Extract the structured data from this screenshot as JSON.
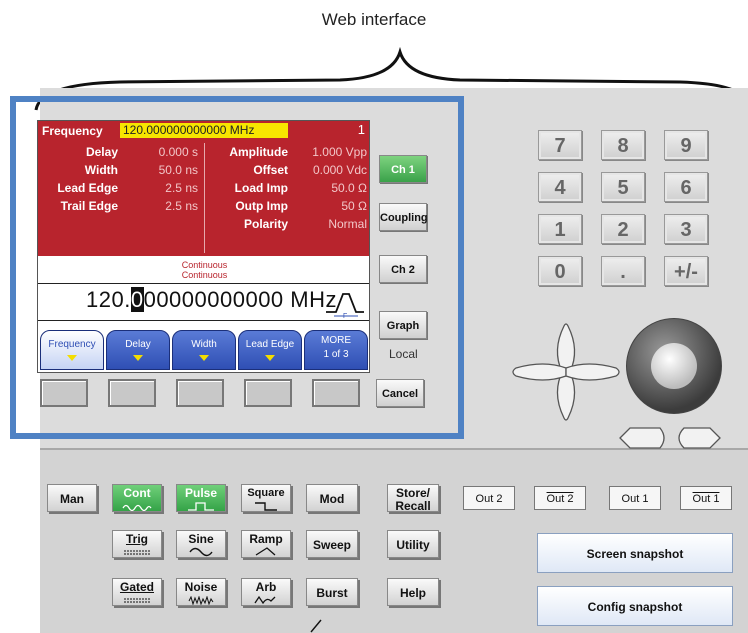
{
  "caption": "Web interface",
  "screen": {
    "header": {
      "label": "Frequency",
      "value": "120.000000000000 MHz",
      "channel": "1"
    },
    "params_left": [
      {
        "label": "Delay",
        "value": "0.000 s"
      },
      {
        "label": "Width",
        "value": "50.0 ns"
      },
      {
        "label": "Lead Edge",
        "value": "2.5 ns"
      },
      {
        "label": "Trail Edge",
        "value": "2.5 ns"
      }
    ],
    "params_right": [
      {
        "label": "Amplitude",
        "value": "1.000 Vpp"
      },
      {
        "label": "Offset",
        "value": "0.000 Vdc"
      },
      {
        "label": "Load Imp",
        "value": "50.0 Ω"
      },
      {
        "label": "Outp Imp",
        "value": "50 Ω"
      },
      {
        "label": "Polarity",
        "value": "Normal"
      }
    ],
    "mode_line1": "Continuous",
    "mode_line2": "Continuous",
    "entry": {
      "before": "120.",
      "cursor": "0",
      "after": "00000000000 MHz"
    },
    "softkeys": [
      {
        "label": "Frequency",
        "label2": "",
        "active": true,
        "arrow": true
      },
      {
        "label": "Delay",
        "label2": "",
        "active": false,
        "arrow": true
      },
      {
        "label": "Width",
        "label2": "",
        "active": false,
        "arrow": true
      },
      {
        "label": "Lead Edge",
        "label2": "",
        "active": false,
        "arrow": true
      },
      {
        "label": "MORE",
        "label2": "1 of 3",
        "active": false,
        "arrow": false
      }
    ]
  },
  "side_buttons": {
    "ch1": "Ch 1",
    "coupling": "Coupling",
    "ch2": "Ch 2",
    "graph": "Graph",
    "local": "Local",
    "cancel": "Cancel"
  },
  "keypad": [
    "7",
    "8",
    "9",
    "4",
    "5",
    "6",
    "1",
    "2",
    "3",
    "0",
    ".",
    "+/-"
  ],
  "panel_buttons": {
    "man": "Man",
    "cont": "Cont",
    "pulse": "Pulse",
    "square": "Square",
    "mod": "Mod",
    "store": "Store/",
    "recall": "Recall",
    "trig": "Trig",
    "sine": "Sine",
    "ramp": "Ramp",
    "sweep": "Sweep",
    "utility": "Utility",
    "gated": "Gated",
    "noise": "Noise",
    "arb": "Arb",
    "burst": "Burst",
    "help": "Help"
  },
  "outputs": {
    "out2": "Out 2",
    "out2_bar": "Out 2",
    "out1": "Out 1",
    "out1_bar": "Out 1"
  },
  "snapshots": {
    "screen": "Screen snapshot",
    "config": "Config snapshot"
  },
  "colors": {
    "screen_red": "#b8242d",
    "highlight_blue": "#4f82c4",
    "active_green": "#3aa24a",
    "softkey_blue": "#2f4fb4"
  }
}
